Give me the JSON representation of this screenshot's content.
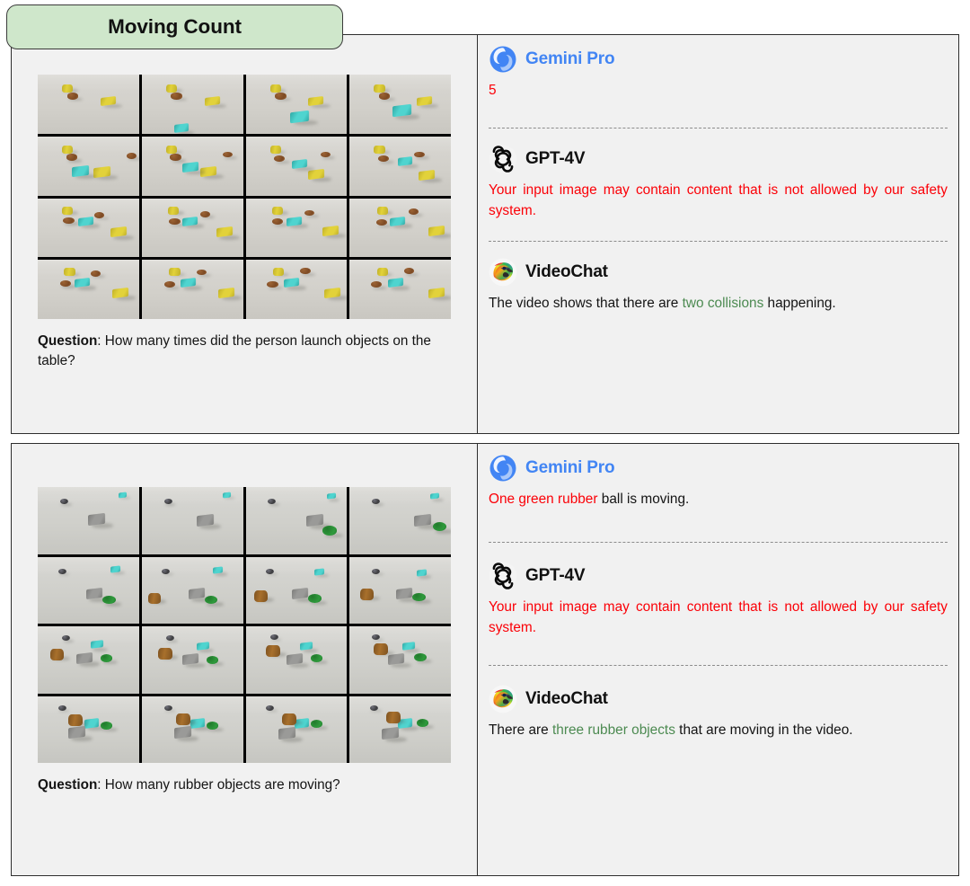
{
  "title_badge": {
    "label": "Moving Count"
  },
  "panels": [
    {
      "question_prefix": "Question",
      "question_sep": ": ",
      "question_text": "How many times did the person launch objects on the table?",
      "responses": [
        {
          "model": "Gemini Pro",
          "logo": "gemini-logo",
          "name_color": "#4285f4",
          "segments": [
            {
              "text": "5",
              "color": "red"
            }
          ]
        },
        {
          "model": "GPT-4V",
          "logo": "openai-logo",
          "name_color": "#111111",
          "segments": [
            {
              "text": "Your input image may contain content that is not allowed by our safety system.",
              "color": "red"
            }
          ]
        },
        {
          "model": "VideoChat",
          "logo": "videochat-parrot-logo",
          "name_color": "#111111",
          "segments": [
            {
              "text": "The video shows that there are ",
              "color": "black"
            },
            {
              "text": "two collisions",
              "color": "green"
            },
            {
              "text": " happening.",
              "color": "black"
            }
          ]
        }
      ]
    },
    {
      "question_prefix": "Question",
      "question_sep": ": ",
      "question_text": "How many rubber objects are moving?",
      "responses": [
        {
          "model": "Gemini Pro",
          "logo": "gemini-logo",
          "name_color": "#4285f4",
          "segments": [
            {
              "text": "One green rubber",
              "color": "red"
            },
            {
              "text": " ball is moving.",
              "color": "black"
            }
          ]
        },
        {
          "model": "GPT-4V",
          "logo": "openai-logo",
          "name_color": "#111111",
          "segments": [
            {
              "text": "Your input image may contain content that is not allowed by our safety system.",
              "color": "red"
            }
          ]
        },
        {
          "model": "VideoChat",
          "logo": "videochat-parrot-logo",
          "name_color": "#111111",
          "segments": [
            {
              "text": "There are ",
              "color": "black"
            },
            {
              "text": "three rubber objects",
              "color": "green"
            },
            {
              "text": " that are moving in the video.",
              "color": "black"
            }
          ]
        }
      ]
    }
  ],
  "colors": {
    "badge_fill": "#cfe7cb",
    "panel_fill": "#f1f1f1",
    "panel_border": "#2e2e2e",
    "incorrect_red": "#fb0007",
    "correct_green": "#4c8a51",
    "gemini_blue": "#4285f4",
    "text_dark": "#141414"
  },
  "video_frames": {
    "panel_1_note": "4x4 grid of CLEVRER simulation frames: yellow cylinder, brown rubber sphere, cyan cube, yellow cube on gray table",
    "panel_2_note": "4x4 grid of CLEVRER simulation frames: gray cube, green rubber sphere, cyan cube, metal sphere, brown cylinder on gray table"
  }
}
